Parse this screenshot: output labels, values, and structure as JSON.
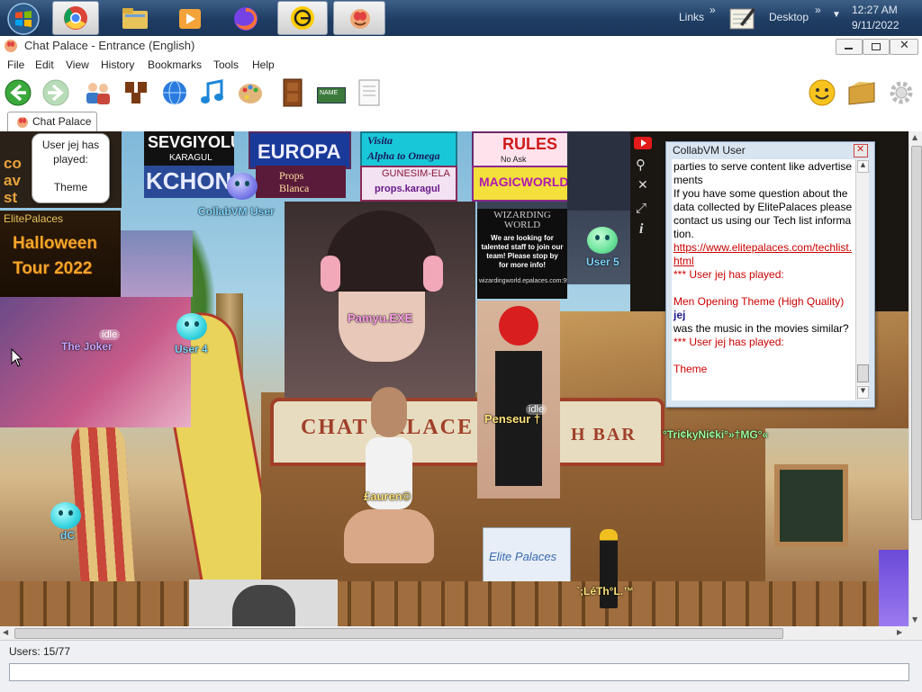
{
  "taskbar": {
    "links_label": "Links",
    "desktop_label": "Desktop",
    "time": "12:27 AM",
    "date": "9/11/2022"
  },
  "window": {
    "title": "Chat Palace - Entrance (English)"
  },
  "menu": [
    "File",
    "Edit",
    "View",
    "History",
    "Bookmarks",
    "Tools",
    "Help"
  ],
  "toolbar": {
    "name_sign": "NAME"
  },
  "tab": {
    "label": "Chat Palace"
  },
  "scene": {
    "props": {
      "sevgiyolu": "SEVGIYOLU",
      "karagul": "KARAGUL",
      "kchon2": "KCHON2",
      "europa": "EUROPA",
      "props_blanca": "Props Blanca",
      "visita": "Visita",
      "alpha_omega": "Alpha to Omega",
      "gunesim_ela": "GUNESIM-ELA",
      "props_karagul": "props.karagul",
      "rules": "RULES",
      "no_ask": "No Ask",
      "magicworld": "MAGICWORLD",
      "elitepalaces": "ElitePalaces",
      "halloween": "Halloween",
      "tour": "Tour 2022",
      "wiz_title": "WIZARDING WORLD",
      "wiz_body": "We are looking for talented staff to join our team! Please stop by for more info!",
      "wiz_url": "wizardingworld.epalaces.com:9998",
      "sign_chat": "CHAT PALACE",
      "sign_bar": "H BAR",
      "elite_banner": "Elite Palaces"
    },
    "bubble": {
      "line1": "User jej has",
      "line2": "played:",
      "line3": "Theme"
    },
    "users": [
      {
        "name": "CollabVM User"
      },
      {
        "name": "Pamyu.EXE"
      },
      {
        "name": "User 5"
      },
      {
        "name": "The Joker"
      },
      {
        "name": "User 4"
      },
      {
        "name": "Penseur †"
      },
      {
        "name": "°Tri¢kyNi¢ki°»†MG°«"
      },
      {
        "name": "£auren©"
      },
      {
        "name": "dC"
      },
      {
        "name": "`;LéTh°L.™"
      }
    ],
    "idle": "idle"
  },
  "chat_panel": {
    "title": "CollabVM User",
    "lines": [
      {
        "text": "parties to serve content like advertisements",
        "color": "#000000"
      },
      {
        "text": "If you have some question about the data collected by ElitePalaces please contact us using our Tech list information.",
        "color": "#000000"
      },
      {
        "text": "https://www.elitepalaces.com/techlist.html",
        "color": "#cc0000",
        "link": true
      },
      {
        "text": "*** User jej has played:",
        "color": "#cc0000"
      },
      {
        "text": "",
        "color": "#cc0000"
      },
      {
        "text": "Men Opening Theme (High Quality)",
        "color": "#cc0000"
      },
      {
        "text": "jej",
        "color": "#1a1a8c",
        "bold": true
      },
      {
        "text": "was the music in the movies similar?",
        "color": "#000000"
      },
      {
        "text": "*** User jej has played:",
        "color": "#cc0000"
      },
      {
        "text": "",
        "color": "#cc0000"
      },
      {
        "text": "Theme",
        "color": "#cc0000"
      }
    ]
  },
  "status": {
    "users": "Users: 15/77",
    "chat_input_placeholder": ""
  },
  "colors": {
    "label_green": "#9cff9c",
    "label_blue": "#7fd7ff",
    "label_pink": "#ff9de8",
    "label_yellow": "#ffe27a",
    "chat_red": "#cc0000"
  }
}
